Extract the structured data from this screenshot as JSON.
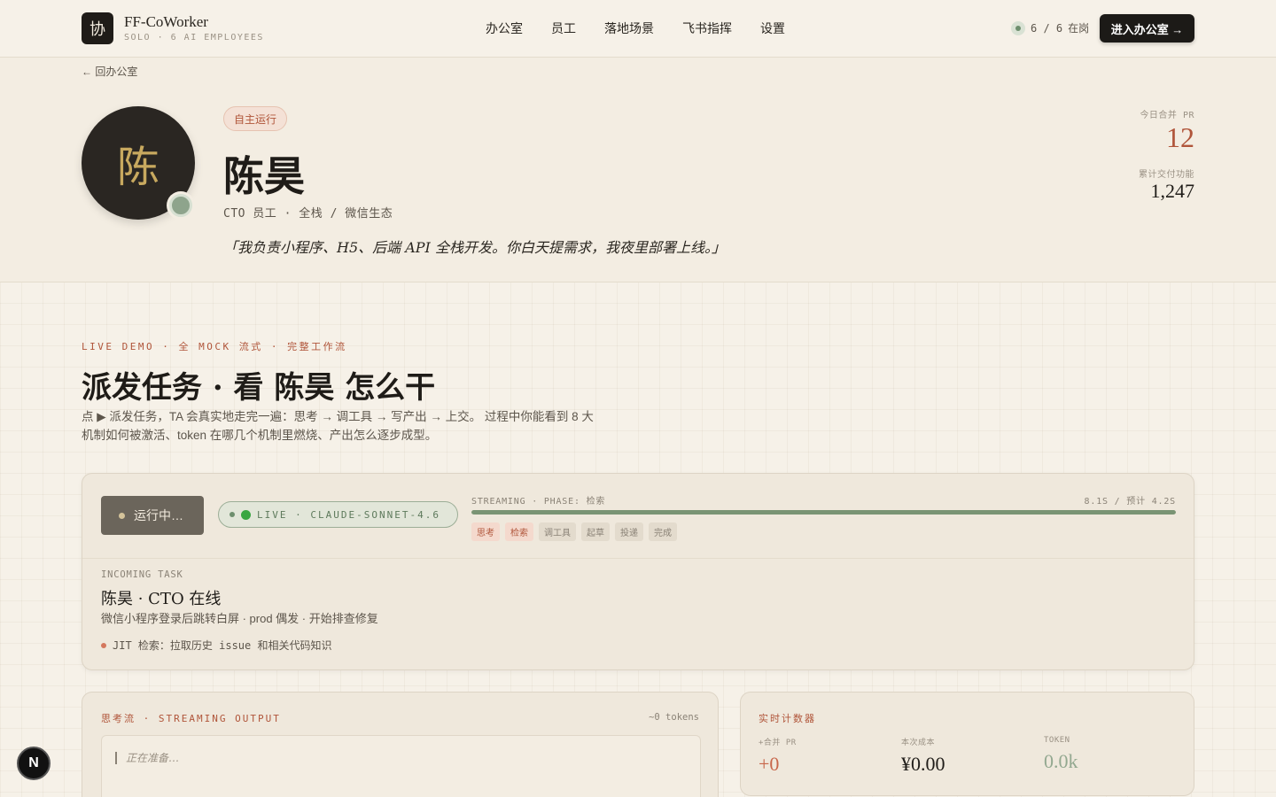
{
  "brand": {
    "logo_char": "协",
    "name": "FF-CoWorker",
    "subtitle": "SOLO · 6 AI EMPLOYEES"
  },
  "nav": [
    "办公室",
    "员工",
    "落地场景",
    "飞书指挥",
    "设置"
  ],
  "online": {
    "count": "6 / 6",
    "label": "在岗"
  },
  "enter_button": "进入办公室 →",
  "back_link": "← 回办公室",
  "profile": {
    "avatar_char": "陈",
    "status": "自主运行",
    "name": "陈昊",
    "role": "CTO 员工 · 全栈 / 微信生态",
    "quote": "「我负责小程序、H5、后端 API 全栈开发。你白天提需求，我夜里部署上线。」",
    "stats": [
      {
        "label": "今日合并 PR",
        "value": "12",
        "color": "#b0553a"
      },
      {
        "label": "累计交付功能",
        "value": "1,247",
        "color": "#1f1c18"
      }
    ]
  },
  "demo": {
    "kicker": "LIVE DEMO · 全 MOCK 流式 · 完整工作流",
    "title": "派发任务 · 看 陈昊 怎么干",
    "description": "点 ▶ 派发任务，TA 会真实地走完一遍：思考 → 调工具 → 写产出 → 上交。 过程中你能看到 8 大机制如何被激活、token 在哪几个机制里燃烧、产出怎么逐步成型。"
  },
  "runner": {
    "run_button": "运行中…",
    "live_label": "LIVE · CLAUDE-SONNET-4.6",
    "stream_label": "STREAMING · PHASE: 检索",
    "stream_time": "8.1S / 预计 4.2S",
    "progress": 1.0,
    "phases": [
      {
        "label": "思考",
        "active": true
      },
      {
        "label": "检索",
        "active": true
      },
      {
        "label": "调工具",
        "active": false
      },
      {
        "label": "起草",
        "active": false
      },
      {
        "label": "投递",
        "active": false
      },
      {
        "label": "完成",
        "active": false
      }
    ],
    "incoming_label": "INCOMING TASK",
    "task_title": "陈昊 · CTO 在线",
    "task_desc": "微信小程序登录后跳转白屏 · prod 偶发 · 开始排查修复",
    "task_log": "JIT 检索：拉取历史 issue 和相关代码知识"
  },
  "thinking": {
    "header": "思考流 · STREAMING OUTPUT",
    "tokens": "~0 tokens",
    "placeholder": "正在准备…"
  },
  "counters": {
    "header": "实时计数器",
    "items": [
      {
        "label": "+合并 PR",
        "value": "+0",
        "color": "#c7664a"
      },
      {
        "label": "本次成本",
        "value": "¥0.00",
        "color": "#1f1c18"
      },
      {
        "label": "TOKEN",
        "value": "0.0k",
        "color": "#93a890"
      }
    ]
  },
  "next_badge": "N"
}
